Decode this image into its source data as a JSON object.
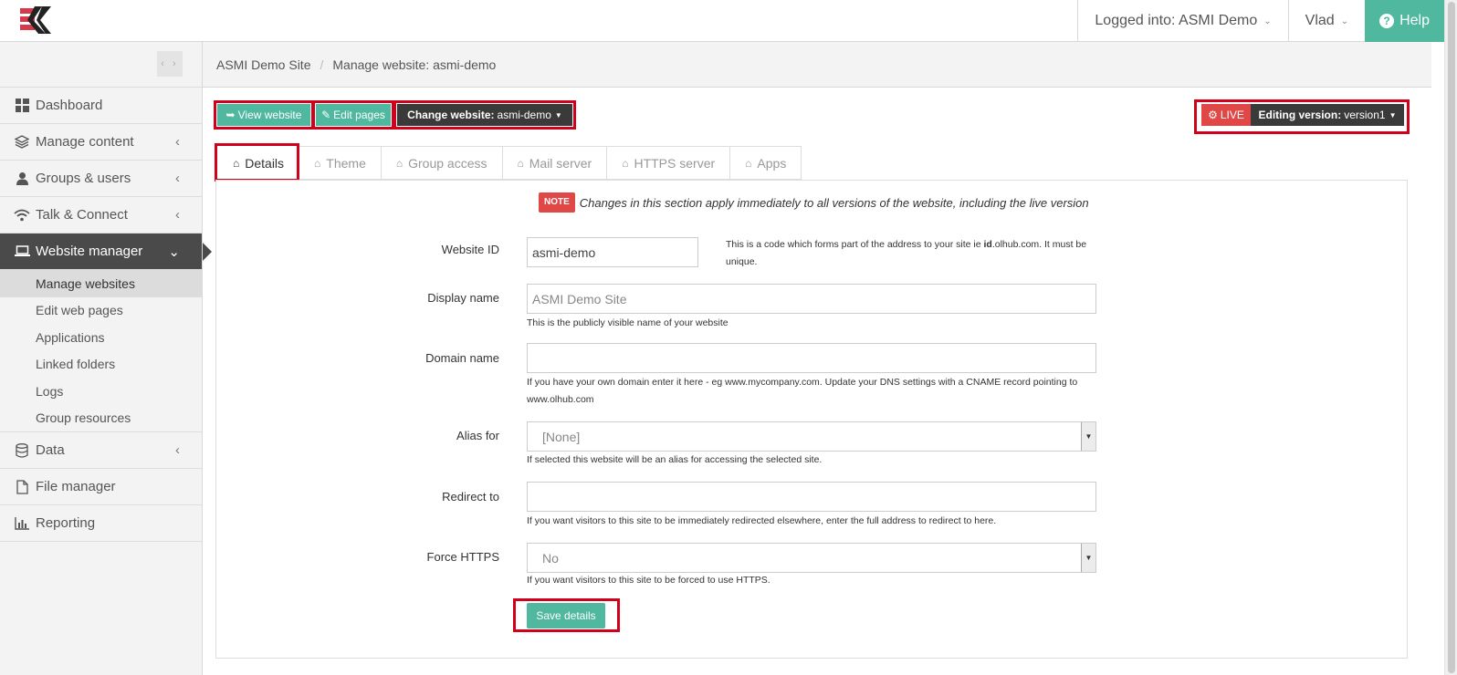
{
  "topbar": {
    "logged_into": "Logged into: ASMI Demo",
    "user": "Vlad",
    "help": "Help"
  },
  "sidebar": {
    "toggle": "‹ ›",
    "items": [
      {
        "label": "Dashboard",
        "icon": "dashboard-icon"
      },
      {
        "label": "Manage content",
        "icon": "layers-icon"
      },
      {
        "label": "Groups & users",
        "icon": "user-icon"
      },
      {
        "label": "Talk & Connect",
        "icon": "wifi-icon"
      },
      {
        "label": "Website manager",
        "icon": "laptop-icon"
      }
    ],
    "sub_items": [
      "Manage websites",
      "Edit web pages",
      "Applications",
      "Linked folders",
      "Logs",
      "Group resources"
    ],
    "items_after": [
      {
        "label": "Data",
        "icon": "database-icon"
      },
      {
        "label": "File manager",
        "icon": "file-icon"
      },
      {
        "label": "Reporting",
        "icon": "chart-icon"
      }
    ]
  },
  "breadcrumb": {
    "site": "ASMI Demo Site",
    "page": "Manage website: asmi-demo"
  },
  "toolbar": {
    "view_website": "View website",
    "edit_pages": "Edit pages",
    "change_website_label": "Change website:",
    "change_website_value": "asmi-demo",
    "live": "LIVE",
    "editing_version_label": "Editing version:",
    "editing_version_value": "version1"
  },
  "tabs": [
    "Details",
    "Theme",
    "Group access",
    "Mail server",
    "HTTPS server",
    "Apps"
  ],
  "note": {
    "badge": "NOTE",
    "text": "Changes in this section apply immediately to all versions of the website, including the live version"
  },
  "form": {
    "website_id": {
      "label": "Website ID",
      "value": "asmi-demo",
      "help_pre": "This is a code which forms part of the address to your site ie ",
      "help_bold": "id",
      "help_post": ".olhub.com. It must be",
      "help_line2": "unique."
    },
    "display_name": {
      "label": "Display name",
      "value": "ASMI Demo Site",
      "help": "This is the publicly visible name of your website"
    },
    "domain_name": {
      "label": "Domain name",
      "value": "",
      "help_line1": "If you have your own domain enter it here - eg www.mycompany.com. Update your DNS settings with a CNAME record pointing to",
      "help_line2": "www.olhub.com"
    },
    "alias_for": {
      "label": "Alias for",
      "value": "[None]",
      "help": "If selected this website will be an alias for accessing the selected site."
    },
    "redirect_to": {
      "label": "Redirect to",
      "value": "",
      "help": "If you want visitors to this site to be immediately redirected elsewhere, enter the full address to redirect to here."
    },
    "force_https": {
      "label": "Force HTTPS",
      "value": "No",
      "help": "If you want visitors to this site to be forced to use HTTPS."
    },
    "save_label": "Save details"
  },
  "colors": {
    "accent_green": "#4fb89e",
    "live_red": "#e04848",
    "dark": "#3a3a3a",
    "highlight_red": "#d0021b"
  }
}
